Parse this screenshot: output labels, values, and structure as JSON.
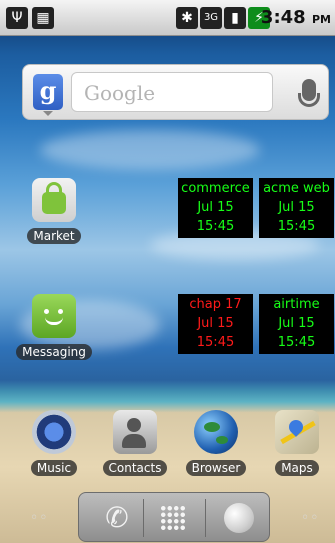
{
  "status_bar": {
    "time": "3:48",
    "ampm": "PM",
    "icons": [
      "usb-icon",
      "android-debug-icon",
      "bluetooth-icon",
      "3g-icon",
      "signal-icon",
      "battery-icon"
    ]
  },
  "search_widget": {
    "placeholder": "Google",
    "logo": "g"
  },
  "apps": [
    {
      "label": "Market"
    },
    {
      "label": "Messaging"
    }
  ],
  "widgets": [
    {
      "name": "commerce",
      "time": "Jul 15 15:45",
      "color": "#17ff17"
    },
    {
      "name": "acme web",
      "time": "Jul 15 15:45",
      "color": "#17ff17"
    },
    {
      "name": "chap 17",
      "time": "Jul 15 15:45",
      "color": "#ff1a1a"
    },
    {
      "name": "airtime",
      "time": "Jul 15 15:45",
      "color": "#17ff17"
    }
  ],
  "shortcuts": [
    {
      "label": "Music"
    },
    {
      "label": "Contacts"
    },
    {
      "label": "Browser"
    },
    {
      "label": "Maps"
    }
  ],
  "dock": {
    "left_dots": "◦◦",
    "right_dots": "◦◦"
  }
}
